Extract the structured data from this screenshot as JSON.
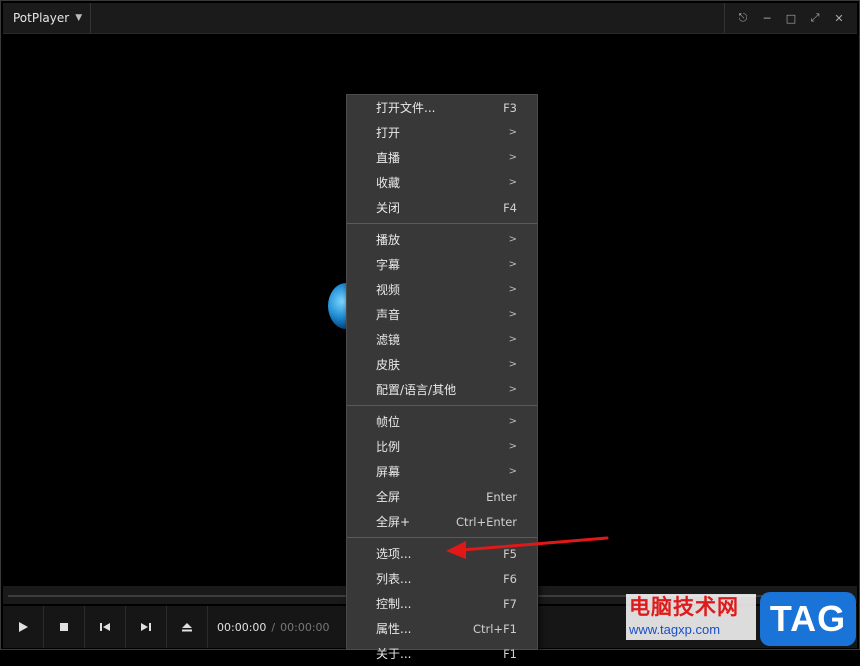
{
  "app": {
    "title": "PotPlayer"
  },
  "window_controls": [
    "pin-icon",
    "minimize-icon",
    "maximize-icon",
    "fullscreen-icon",
    "close-icon"
  ],
  "player": {
    "current_time": "00:00:00",
    "total_time": "00:00:00",
    "controls": [
      "play-icon",
      "stop-icon",
      "previous-icon",
      "next-icon",
      "eject-icon"
    ]
  },
  "context_menu": {
    "groups": [
      [
        {
          "label": "打开文件...",
          "shortcut": "F3"
        },
        {
          "label": "打开",
          "submenu": ">"
        },
        {
          "label": "直播",
          "submenu": ">"
        },
        {
          "label": "收藏",
          "submenu": ">"
        },
        {
          "label": "关闭",
          "shortcut": "F4"
        }
      ],
      [
        {
          "label": "播放",
          "submenu": ">"
        },
        {
          "label": "字幕",
          "submenu": ">"
        },
        {
          "label": "视频",
          "submenu": ">"
        },
        {
          "label": "声音",
          "submenu": ">"
        },
        {
          "label": "滤镜",
          "submenu": ">"
        },
        {
          "label": "皮肤",
          "submenu": ">"
        },
        {
          "label": "配置/语言/其他",
          "submenu": ">"
        }
      ],
      [
        {
          "label": "帧位",
          "submenu": ">"
        },
        {
          "label": "比例",
          "submenu": ">"
        },
        {
          "label": "屏幕",
          "submenu": ">"
        },
        {
          "label": "全屏",
          "shortcut": "Enter"
        },
        {
          "label": "全屏+",
          "shortcut": "Ctrl+Enter"
        }
      ],
      [
        {
          "label": "选项...",
          "shortcut": "F5"
        },
        {
          "label": "列表...",
          "shortcut": "F6"
        },
        {
          "label": "控制...",
          "shortcut": "F7"
        },
        {
          "label": "属性...",
          "shortcut": "Ctrl+F1"
        },
        {
          "label": "关于...",
          "shortcut": "F1"
        }
      ]
    ]
  },
  "watermark": {
    "title": "电脑技术网",
    "url": "www.tagxp.com",
    "badge": "TAG"
  },
  "colors": {
    "menu_bg": "#383838",
    "arrow": "#e01818",
    "watermark_red": "#e01a1a",
    "watermark_blue": "#1a73d6"
  }
}
